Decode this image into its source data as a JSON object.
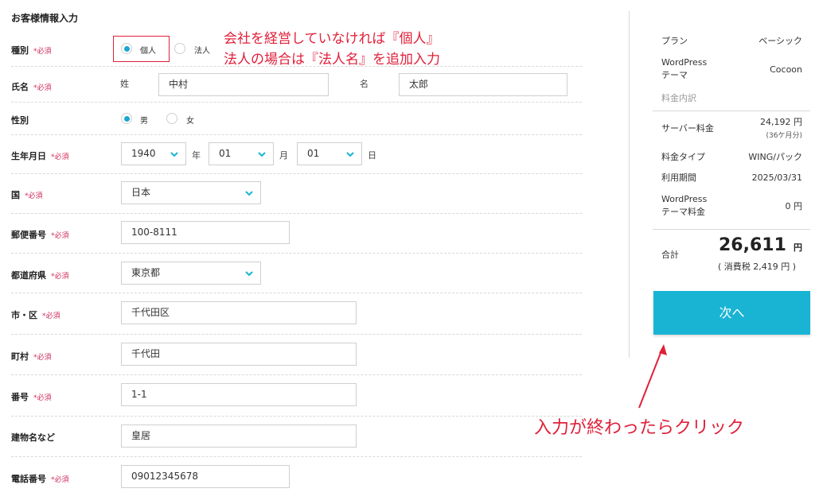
{
  "form": {
    "section_title": "お客様情報入力",
    "required_mark": "*必須",
    "type": {
      "label": "種別",
      "options": [
        "個人",
        "法人"
      ],
      "selected": "個人"
    },
    "name": {
      "label": "氏名",
      "sei_label": "姓",
      "sei_value": "中村",
      "mei_label": "名",
      "mei_value": "太郎"
    },
    "gender": {
      "label": "性別",
      "options": [
        "男",
        "女"
      ],
      "selected": "男"
    },
    "birth": {
      "label": "生年月日",
      "year": "1940",
      "year_unit": "年",
      "month": "01",
      "month_unit": "月",
      "day": "01",
      "day_unit": "日"
    },
    "country": {
      "label": "国",
      "value": "日本"
    },
    "postal": {
      "label": "郵便番号",
      "value": "100-8111"
    },
    "prefecture": {
      "label": "都道府県",
      "value": "東京都"
    },
    "city": {
      "label": "市・区",
      "value": "千代田区"
    },
    "town": {
      "label": "町村",
      "value": "千代田"
    },
    "number": {
      "label": "番号",
      "value": "1-1"
    },
    "building": {
      "label": "建物名など",
      "value": "皇居"
    },
    "phone": {
      "label": "電話番号",
      "value": "09012345678"
    }
  },
  "annotations": {
    "line1": "会社を経営していなければ『個人』",
    "line2": "法人の場合は『法人名』を追加入力",
    "click_hint": "入力が終わったらクリック"
  },
  "summary": {
    "plan_label": "プラン",
    "plan_value": "ベーシック",
    "theme_label_1": "WordPress",
    "theme_label_2": "テーマ",
    "theme_value": "Cocoon",
    "breakdown_label": "料金内訳",
    "server_label": "サーバー料金",
    "server_value": "24,192 円",
    "server_note": "(36ケ月分)",
    "type_label": "料金タイプ",
    "type_value": "WING/パック",
    "period_label": "利用期間",
    "period_value": "2025/03/31",
    "theme_fee_label_1": "WordPress",
    "theme_fee_label_2": "テーマ料金",
    "theme_fee_value": "0 円",
    "total_label": "合計",
    "total_value": "26,611",
    "total_unit": "円",
    "tax_note": "( 消費税 2,419 円 )",
    "next_button": "次へ"
  },
  "colors": {
    "accent": "#19b4d4",
    "required": "#d02a5a",
    "annotation": "#e0203a"
  }
}
